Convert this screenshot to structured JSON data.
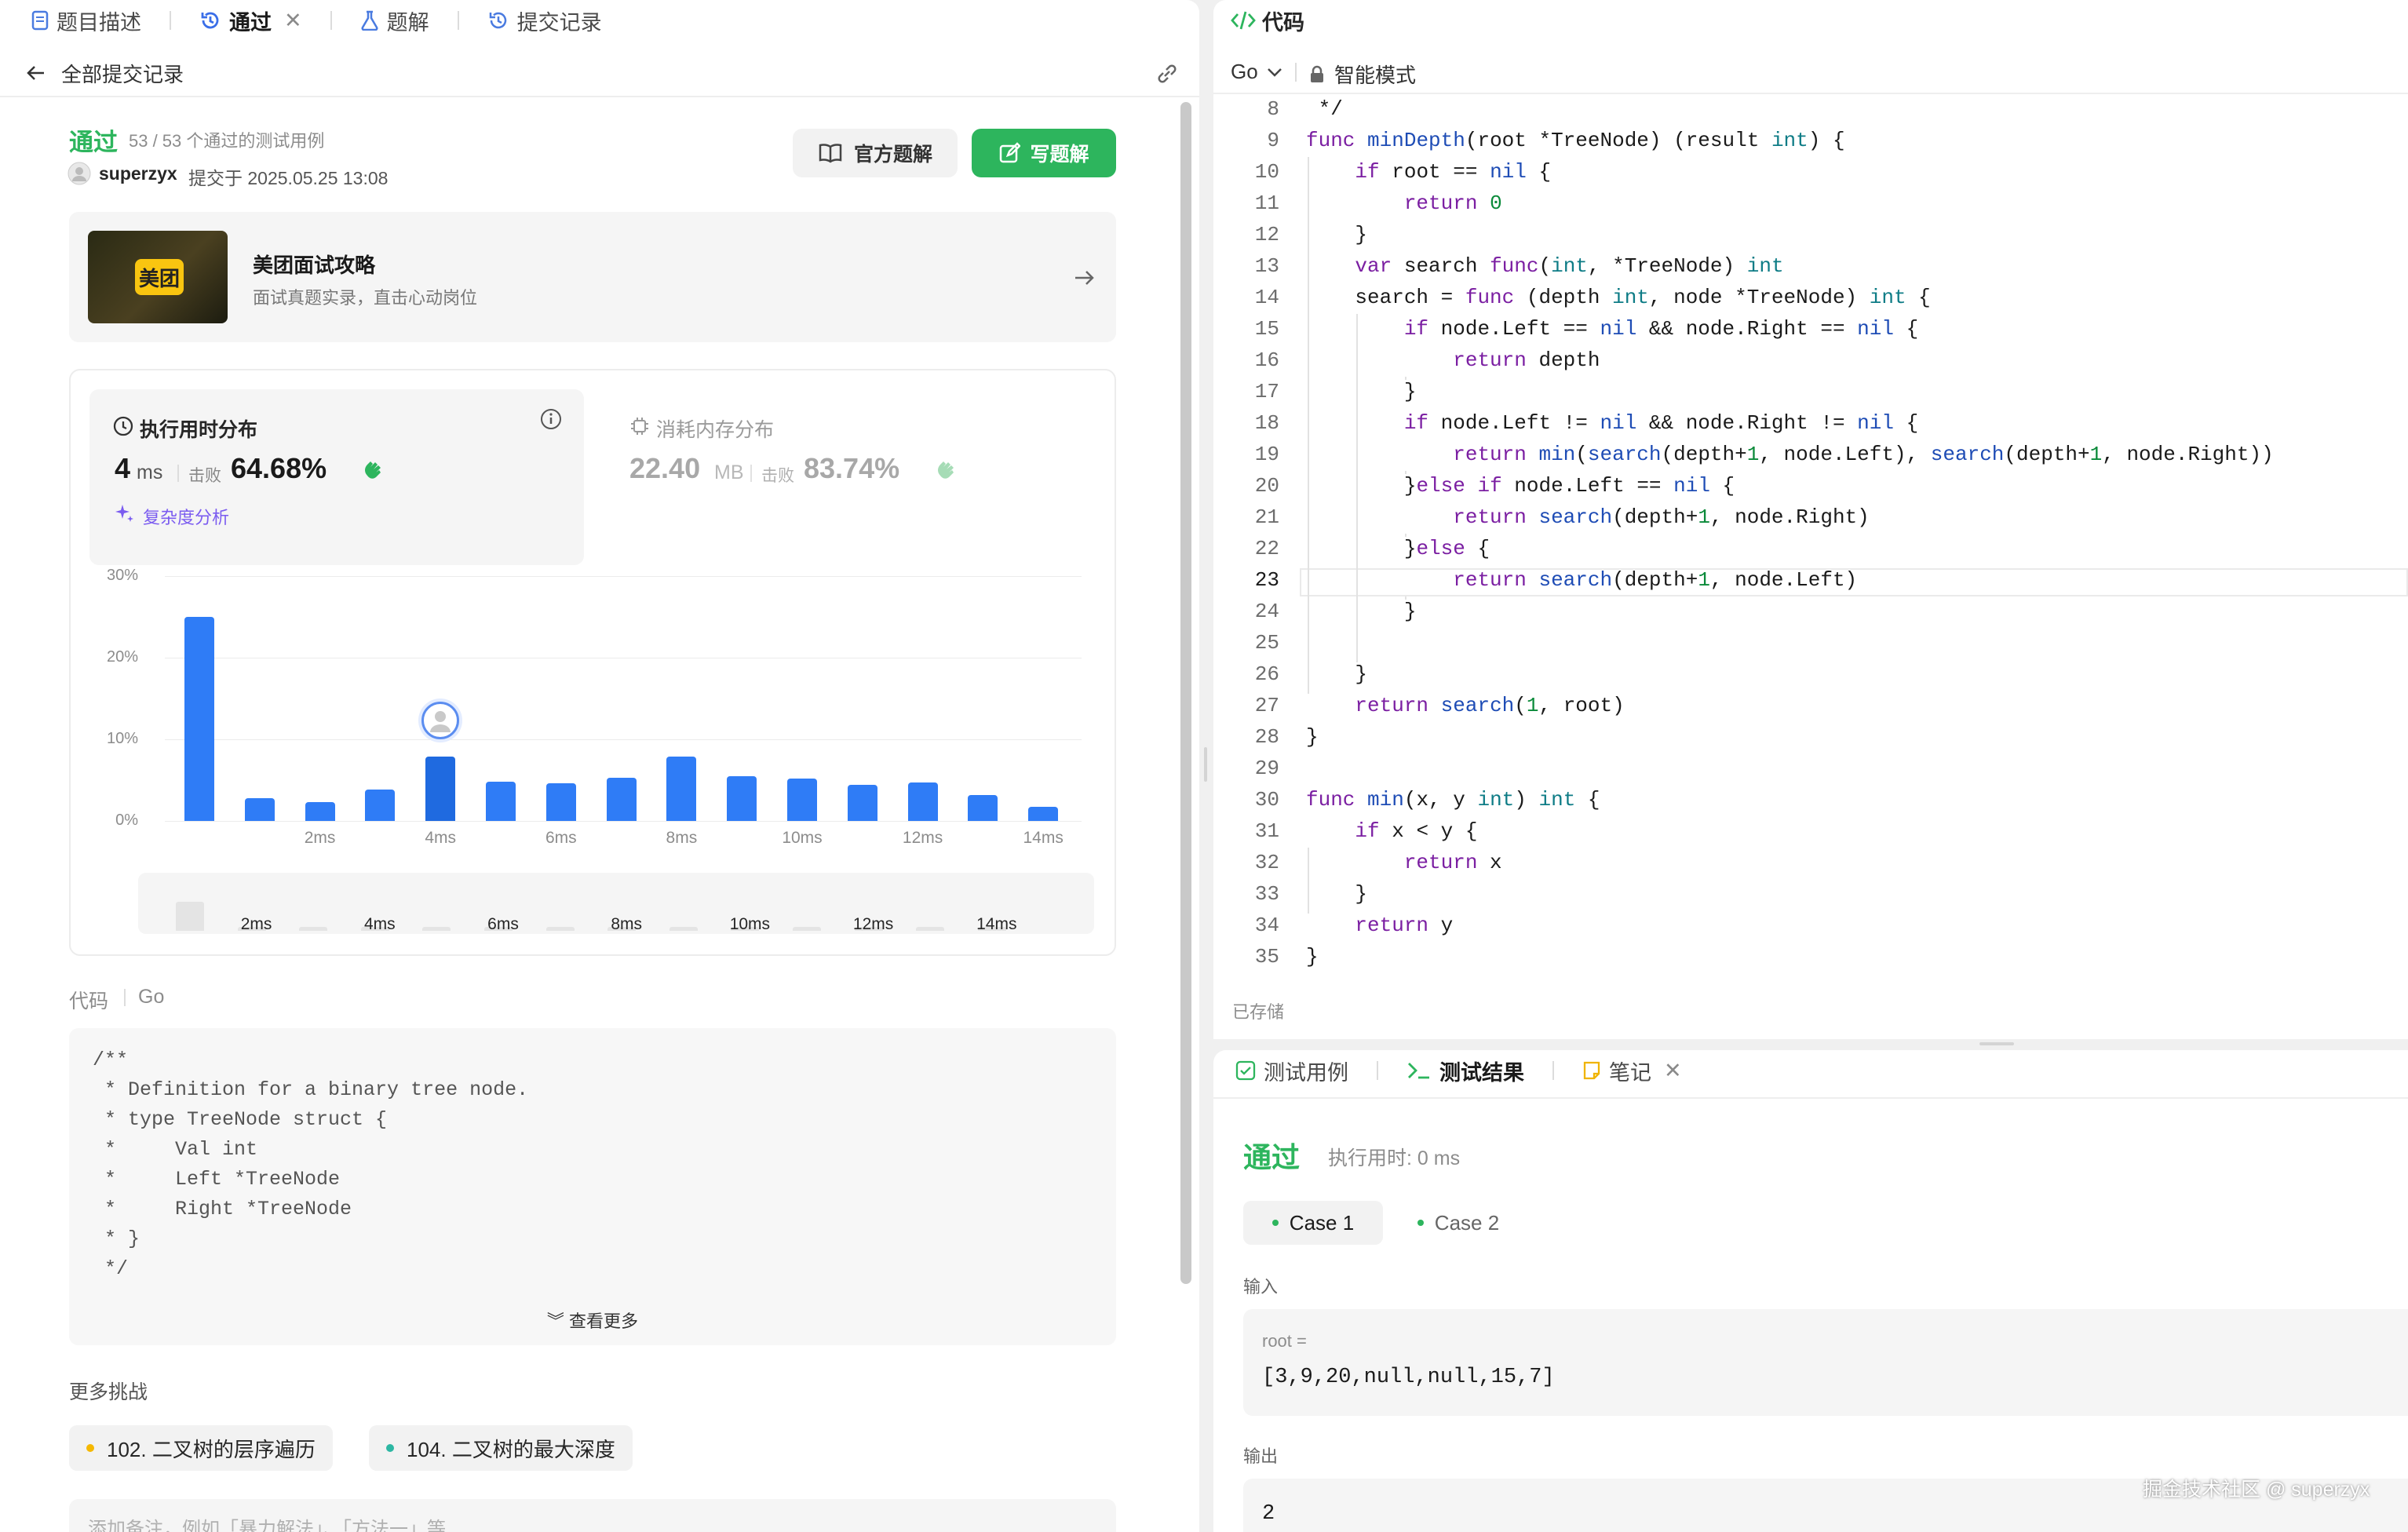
{
  "left": {
    "tabs": [
      {
        "label": "题目描述"
      },
      {
        "label": "通过",
        "close": "✕"
      },
      {
        "label": "题解"
      },
      {
        "label": "提交记录"
      }
    ],
    "back_label": "全部提交记录",
    "result": {
      "status": "通过",
      "tests": "53 / 53 个通过的测试用例",
      "user": "superzyx",
      "submitted": "提交于 2025.05.25 13:08"
    },
    "buttons": {
      "official": "官方题解",
      "write": "写题解"
    },
    "ad": {
      "logo_text": "美团",
      "title": "美团面试攻略",
      "subtitle": "面试真题实录，直击心动岗位"
    },
    "runtime": {
      "title": "执行用时分布",
      "value": "4",
      "unit": "ms",
      "beats_label": "击败",
      "beats": "64.68%",
      "analysis": "复杂度分析"
    },
    "memory": {
      "title": "消耗内存分布",
      "value": "22.40",
      "unit": "MB",
      "beats_label": "击败",
      "beats": "83.74%"
    },
    "code_header": {
      "label": "代码",
      "lang": "Go"
    },
    "code_preview": [
      "/**",
      " * Definition for a binary tree node.",
      " * type TreeNode struct {",
      " *     Val int",
      " *     Left *TreeNode",
      " *     Right *TreeNode",
      " * }",
      " */"
    ],
    "show_more": "查看更多",
    "more_challenges": {
      "title": "更多挑战",
      "items": [
        {
          "label": "102. 二叉树的层序遍历",
          "color": "#f5b800"
        },
        {
          "label": "104. 二叉树的最大深度",
          "color": "#2db7a3"
        }
      ]
    },
    "note_placeholder": "添加备注，例如「暴力解法」、「方法一」等"
  },
  "chart_data": {
    "type": "bar",
    "title": "",
    "ylabel": "",
    "xlabel": "",
    "yticks": [
      "30%",
      "20%",
      "10%",
      "0%"
    ],
    "ylim": [
      0,
      30
    ],
    "x_tick_labels": [
      "2ms",
      "4ms",
      "6ms",
      "8ms",
      "10ms",
      "12ms",
      "14ms"
    ],
    "values": [
      25,
      2.8,
      2.3,
      3.8,
      7.9,
      4.8,
      4.6,
      5.3,
      7.9,
      5.5,
      5.2,
      4.4,
      4.7,
      3.2,
      1.7
    ],
    "highlight_index": 4,
    "mini_values": [
      5.5,
      0.8,
      0.8,
      0.8,
      0.8,
      0.8,
      0.8,
      0.8,
      0.8,
      0.8,
      0.8,
      0.8,
      0.8,
      0.8
    ]
  },
  "right": {
    "title": "代码",
    "lang": "Go",
    "mode": "智能模式",
    "saved": "已存储",
    "current_line": 23,
    "code": [
      {
        "n": 8,
        "t": " */"
      },
      {
        "n": 9,
        "t": "func minDepth(root *TreeNode) (result int) {"
      },
      {
        "n": 10,
        "t": "    if root == nil {"
      },
      {
        "n": 11,
        "t": "        return 0"
      },
      {
        "n": 12,
        "t": "    }"
      },
      {
        "n": 13,
        "t": "    var search func(int, *TreeNode) int"
      },
      {
        "n": 14,
        "t": "    search = func (depth int, node *TreeNode) int {"
      },
      {
        "n": 15,
        "t": "        if node.Left == nil && node.Right == nil {"
      },
      {
        "n": 16,
        "t": "            return depth"
      },
      {
        "n": 17,
        "t": "        }"
      },
      {
        "n": 18,
        "t": "        if node.Left != nil && node.Right != nil {"
      },
      {
        "n": 19,
        "t": "            return min(search(depth+1, node.Left), search(depth+1, node.Right))"
      },
      {
        "n": 20,
        "t": "        }else if node.Left == nil {"
      },
      {
        "n": 21,
        "t": "            return search(depth+1, node.Right)"
      },
      {
        "n": 22,
        "t": "        }else {"
      },
      {
        "n": 23,
        "t": "            return search(depth+1, node.Left)"
      },
      {
        "n": 24,
        "t": "        }"
      },
      {
        "n": 25,
        "t": ""
      },
      {
        "n": 26,
        "t": "    }"
      },
      {
        "n": 27,
        "t": "    return search(1, root)"
      },
      {
        "n": 28,
        "t": "}"
      },
      {
        "n": 29,
        "t": ""
      },
      {
        "n": 30,
        "t": "func min(x, y int) int {"
      },
      {
        "n": 31,
        "t": "    if x < y {"
      },
      {
        "n": 32,
        "t": "        return x"
      },
      {
        "n": 33,
        "t": "    }"
      },
      {
        "n": 34,
        "t": "    return y"
      },
      {
        "n": 35,
        "t": "}"
      }
    ],
    "bottom_tabs": [
      {
        "label": "测试用例"
      },
      {
        "label": "测试结果"
      },
      {
        "label": "笔记",
        "close": "✕"
      }
    ],
    "test": {
      "status": "通过",
      "runtime": "执行用时: 0 ms",
      "cases": [
        "Case 1",
        "Case 2"
      ],
      "input_label": "输入",
      "var_label": "root =",
      "input": "[3,9,20,null,null,15,7]",
      "output_label": "输出",
      "output": "2"
    },
    "watermark": "掘金技术社区 @ superzyx"
  }
}
